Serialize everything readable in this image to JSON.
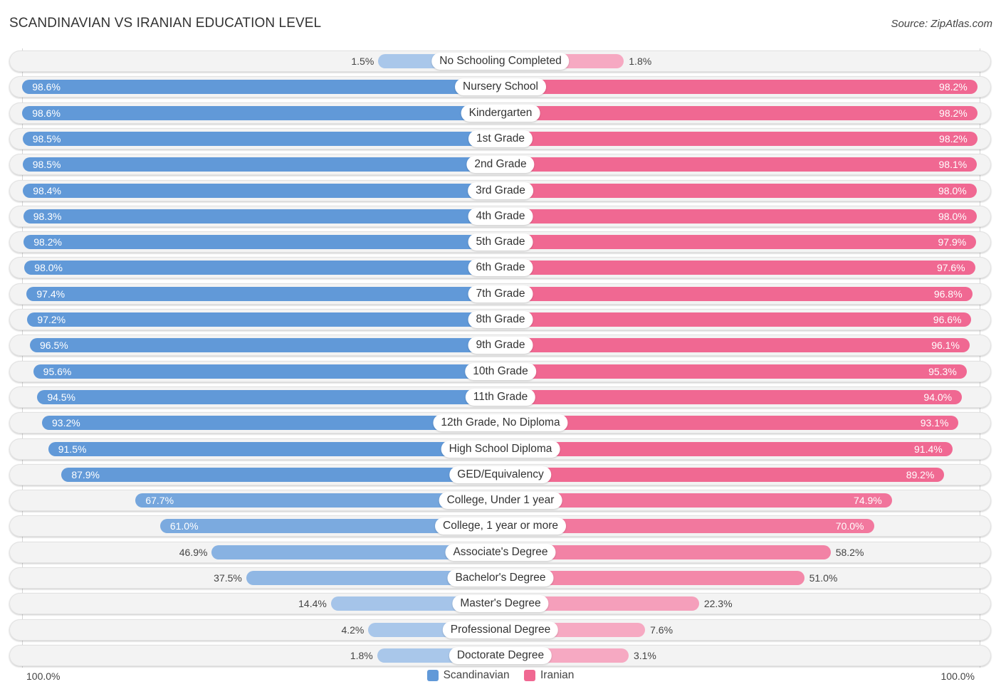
{
  "header": {
    "title": "SCANDINAVIAN VS IRANIAN EDUCATION LEVEL",
    "source": "Source: ZipAtlas.com"
  },
  "colors": {
    "scandinavian_strong": "#6199d8",
    "scandinavian_light": "#a9c7ea",
    "iranian_strong": "#f06892",
    "iranian_light": "#f6a9c2"
  },
  "axis": {
    "left_label": "100.0%",
    "right_label": "100.0%"
  },
  "legend": [
    {
      "name": "Scandinavian",
      "color": "#6199d8"
    },
    {
      "name": "Iranian",
      "color": "#f06892"
    }
  ],
  "chart_data": {
    "type": "bar",
    "orientation": "horizontal-diverging",
    "title": "SCANDINAVIAN VS IRANIAN EDUCATION LEVEL",
    "xlabel": "",
    "ylabel": "",
    "xlim": [
      0,
      100
    ],
    "unit": "%",
    "legend_position": "bottom",
    "categories": [
      "No Schooling Completed",
      "Nursery School",
      "Kindergarten",
      "1st Grade",
      "2nd Grade",
      "3rd Grade",
      "4th Grade",
      "5th Grade",
      "6th Grade",
      "7th Grade",
      "8th Grade",
      "9th Grade",
      "10th Grade",
      "11th Grade",
      "12th Grade, No Diploma",
      "High School Diploma",
      "GED/Equivalency",
      "College, Under 1 year",
      "College, 1 year or more",
      "Associate's Degree",
      "Bachelor's Degree",
      "Master's Degree",
      "Professional Degree",
      "Doctorate Degree"
    ],
    "series": [
      {
        "name": "Scandinavian",
        "side": "left",
        "values": [
          1.5,
          98.6,
          98.6,
          98.5,
          98.5,
          98.4,
          98.3,
          98.2,
          98.0,
          97.4,
          97.2,
          96.5,
          95.6,
          94.5,
          93.2,
          91.5,
          87.9,
          67.7,
          61.0,
          46.9,
          37.5,
          14.4,
          4.2,
          1.8
        ]
      },
      {
        "name": "Iranian",
        "side": "right",
        "values": [
          1.8,
          98.2,
          98.2,
          98.2,
          98.1,
          98.0,
          98.0,
          97.9,
          97.6,
          96.8,
          96.6,
          96.1,
          95.3,
          94.0,
          93.1,
          91.4,
          89.2,
          74.9,
          70.0,
          58.2,
          51.0,
          22.3,
          7.6,
          3.1
        ]
      }
    ]
  }
}
